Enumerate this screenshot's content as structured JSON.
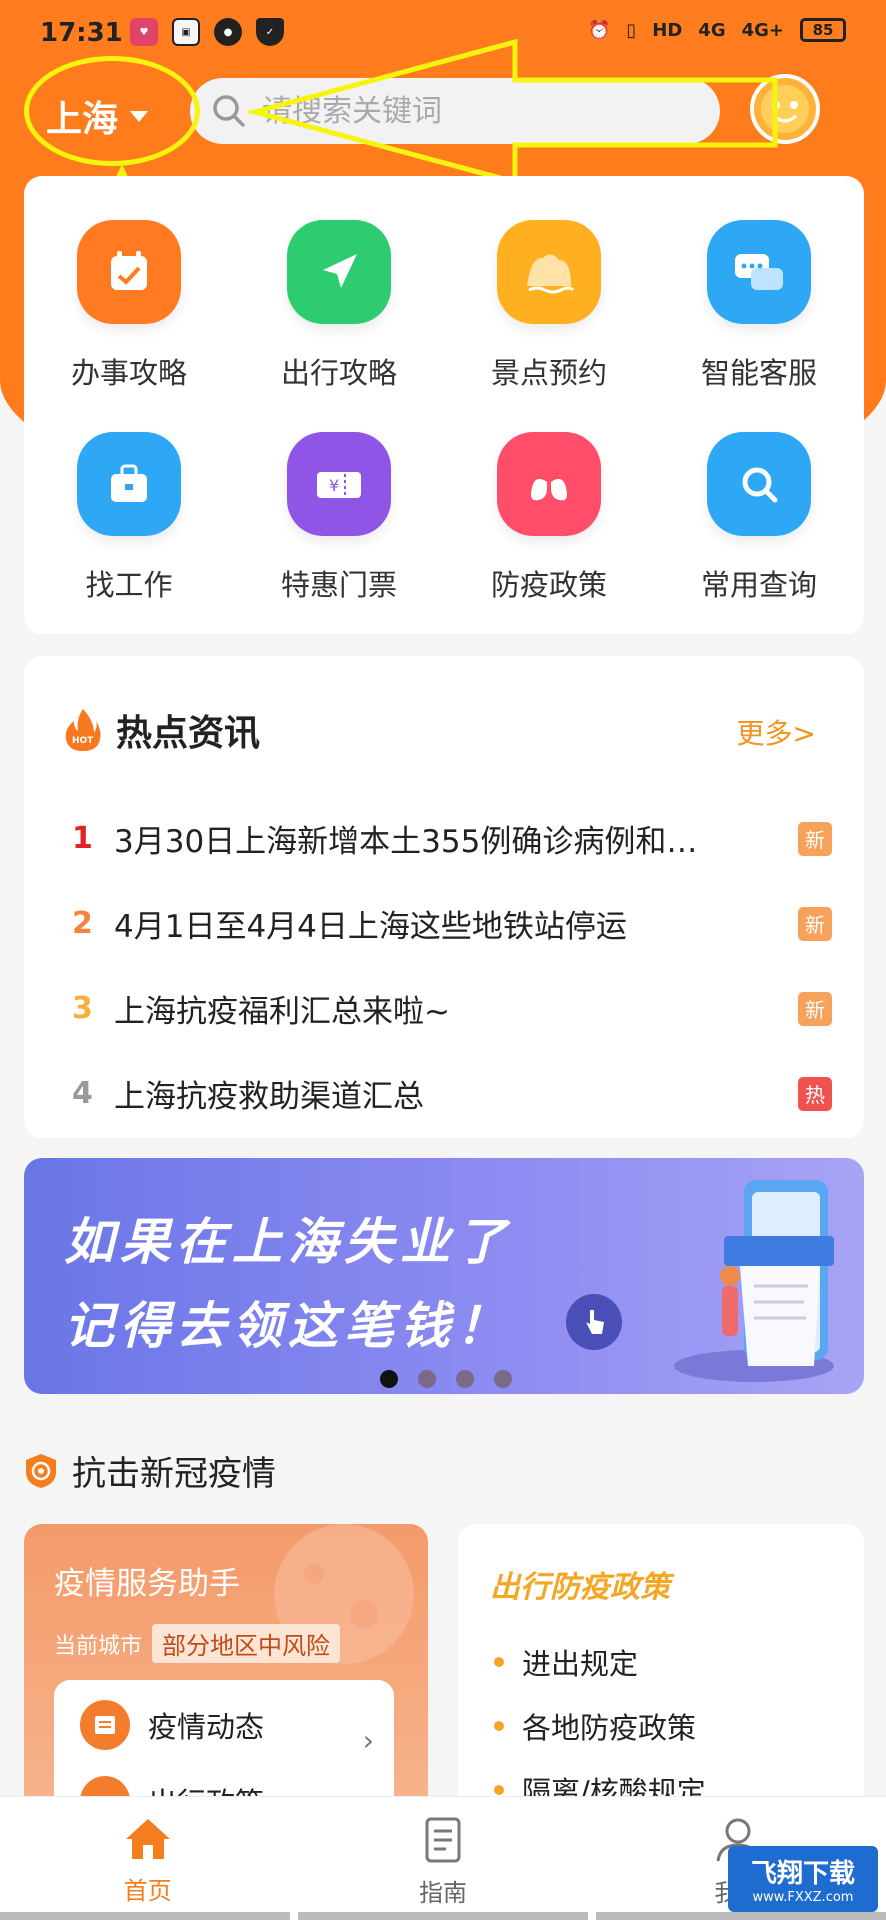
{
  "status": {
    "time": "17:31",
    "net_a": "HD",
    "net_b": "4G",
    "net_c": "4G+",
    "battery": "85"
  },
  "header": {
    "city": "上海",
    "search_placeholder": "请搜索关键词"
  },
  "services": [
    {
      "label": "办事攻略",
      "icon": "calendar-check-icon",
      "color": "#ff7a21"
    },
    {
      "label": "出行攻略",
      "icon": "paper-plane-icon",
      "color": "#2ecc71"
    },
    {
      "label": "景点预约",
      "icon": "mountain-icon",
      "color": "#ffb020"
    },
    {
      "label": "智能客服",
      "icon": "chat-bubble-icon",
      "color": "#2ea7f5"
    },
    {
      "label": "找工作",
      "icon": "briefcase-icon",
      "color": "#2ea7f5"
    },
    {
      "label": "特惠门票",
      "icon": "ticket-icon",
      "color": "#8e55e6"
    },
    {
      "label": "防疫政策",
      "icon": "lungs-icon",
      "color": "#ff4d6a"
    },
    {
      "label": "常用查询",
      "icon": "magnifier-icon",
      "color": "#2ea7f5"
    }
  ],
  "news": {
    "title": "热点资讯",
    "hot_tag": "HOT",
    "more": "更多>",
    "items": [
      {
        "rank": "1",
        "text": "3月30日上海新增本土355例确诊病例和…",
        "badge": "新",
        "rank_color": "#e02424",
        "badge_color": "#f7a25a"
      },
      {
        "rank": "2",
        "text": "4月1日至4月4日上海这些地铁站停运",
        "badge": "新",
        "rank_color": "#f5823a",
        "badge_color": "#f7a25a"
      },
      {
        "rank": "3",
        "text": "上海抗疫福利汇总来啦~",
        "badge": "新",
        "rank_color": "#f5b03a",
        "badge_color": "#f7a25a"
      },
      {
        "rank": "4",
        "text": "上海抗疫救助渠道汇总",
        "badge": "热",
        "rank_color": "#999999",
        "badge_color": "#f0524f"
      }
    ]
  },
  "banner": {
    "line1": "如果在上海失业了",
    "line2": "记得去领这笔钱！",
    "active_slide": 1,
    "slide_count": 4
  },
  "covid_section": {
    "title": "抗击新冠疫情",
    "assistant": {
      "title": "疫情服务助手",
      "city_label": "当前城市",
      "risk": "部分地区中风险",
      "row1": "疫情动态",
      "row2": "出行政策"
    },
    "policy": {
      "title": "出行防疫政策",
      "items": [
        "进出规定",
        "各地防疫政策",
        "隔离/核酸规定"
      ]
    }
  },
  "tabs": [
    {
      "label": "首页",
      "icon": "home-icon",
      "active": true
    },
    {
      "label": "指南",
      "icon": "document-icon",
      "active": false
    },
    {
      "label": "我的",
      "icon": "user-icon",
      "active": false
    }
  ],
  "watermark": {
    "line1": "飞翔下载",
    "line2": "www.FXXZ.com"
  },
  "colors": {
    "brand_orange": "#ff7d1e",
    "annotation_yellow": "#f4f40e"
  }
}
